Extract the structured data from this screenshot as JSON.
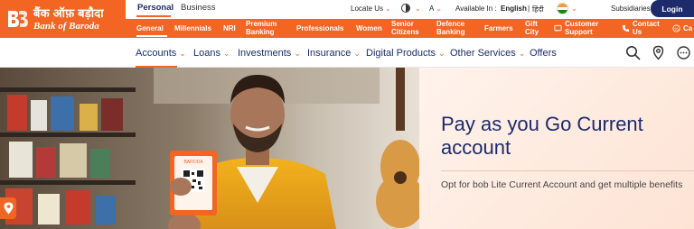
{
  "brand": {
    "hindi_name": "बैंक ऑफ़ बड़ौदा",
    "english_name": "Bank of Baroda",
    "color_orange": "#f26522",
    "color_navy": "#1d2a6b"
  },
  "segment_tabs": [
    {
      "label": "Personal",
      "active": true
    },
    {
      "label": "Business",
      "active": false
    }
  ],
  "utility": {
    "locate_us": "Locate Us",
    "text_size": "A",
    "available_in_label": "Available In :",
    "lang_english": "English",
    "lang_separator": "|",
    "lang_hindi": "हिंदी",
    "subsidiaries": "Subsidiaries",
    "login": "Login"
  },
  "categories": [
    {
      "label": "General",
      "active": true
    },
    {
      "label": "Millennials"
    },
    {
      "label": "NRI"
    },
    {
      "label": "Premium Banking"
    },
    {
      "label": "Professionals"
    },
    {
      "label": "Women"
    },
    {
      "label": "Senior Citizens"
    },
    {
      "label": "Defence Banking"
    },
    {
      "label": "Farmers"
    },
    {
      "label": "Gift City"
    },
    {
      "label": "Customer Support",
      "icon": "support-icon"
    },
    {
      "label": "Contact Us",
      "icon": "phone-icon"
    },
    {
      "label": "Ca",
      "icon": "calculator-icon"
    }
  ],
  "main_nav": [
    {
      "label": "Accounts",
      "active": true
    },
    {
      "label": "Loans"
    },
    {
      "label": "Investments"
    },
    {
      "label": "Insurance"
    },
    {
      "label": "Digital Products"
    },
    {
      "label": "Other Services"
    },
    {
      "label": "Offers"
    }
  ],
  "nav_icons": [
    "search-icon",
    "location-pin-icon",
    "help-chat-icon"
  ],
  "hero": {
    "title": "Pay as you Go Current account",
    "subtitle": "Opt for bob Lite Current Account and get multiple benefits",
    "card_label": "BARODA",
    "panel_color": "#fde3d4"
  }
}
